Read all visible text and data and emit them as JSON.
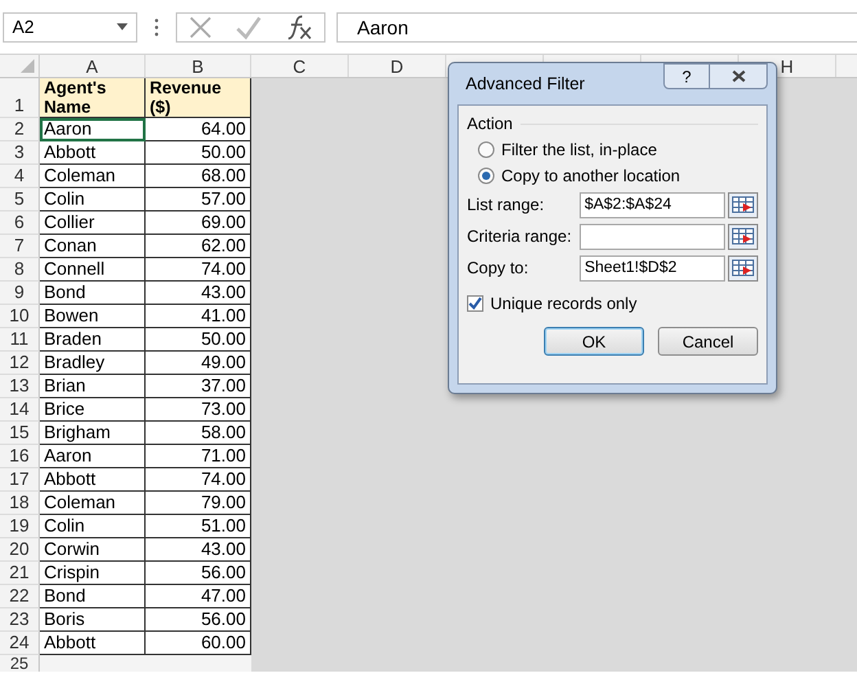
{
  "formula_bar": {
    "name_box": "A2",
    "formula": "Aaron"
  },
  "column_headers": [
    "A",
    "B",
    "C",
    "D"
  ],
  "column_header_right": "H",
  "header_row": {
    "row": "1",
    "cells": [
      "Agent's Name",
      "Revenue ($)"
    ]
  },
  "rows": [
    {
      "row": "2",
      "name": "Aaron",
      "revenue": "64.00",
      "selected": true
    },
    {
      "row": "3",
      "name": "Abbott",
      "revenue": "50.00",
      "selected": false
    },
    {
      "row": "4",
      "name": "Coleman",
      "revenue": "68.00",
      "selected": false
    },
    {
      "row": "5",
      "name": "Colin",
      "revenue": "57.00",
      "selected": false
    },
    {
      "row": "6",
      "name": "Collier",
      "revenue": "69.00",
      "selected": false
    },
    {
      "row": "7",
      "name": "Conan",
      "revenue": "62.00",
      "selected": false
    },
    {
      "row": "8",
      "name": "Connell",
      "revenue": "74.00",
      "selected": false
    },
    {
      "row": "9",
      "name": "Bond",
      "revenue": "43.00",
      "selected": false
    },
    {
      "row": "10",
      "name": "Bowen",
      "revenue": "41.00",
      "selected": false
    },
    {
      "row": "11",
      "name": "Braden",
      "revenue": "50.00",
      "selected": false
    },
    {
      "row": "12",
      "name": "Bradley",
      "revenue": "49.00",
      "selected": false
    },
    {
      "row": "13",
      "name": "Brian",
      "revenue": "37.00",
      "selected": false
    },
    {
      "row": "14",
      "name": "Brice",
      "revenue": "73.00",
      "selected": false
    },
    {
      "row": "15",
      "name": "Brigham",
      "revenue": "58.00",
      "selected": false
    },
    {
      "row": "16",
      "name": "Aaron",
      "revenue": "71.00",
      "selected": false
    },
    {
      "row": "17",
      "name": "Abbott",
      "revenue": "74.00",
      "selected": false
    },
    {
      "row": "18",
      "name": "Coleman",
      "revenue": "79.00",
      "selected": false
    },
    {
      "row": "19",
      "name": "Colin",
      "revenue": "51.00",
      "selected": false
    },
    {
      "row": "20",
      "name": "Corwin",
      "revenue": "43.00",
      "selected": false
    },
    {
      "row": "21",
      "name": "Crispin",
      "revenue": "56.00",
      "selected": false
    },
    {
      "row": "22",
      "name": "Bond",
      "revenue": "47.00",
      "selected": false
    },
    {
      "row": "23",
      "name": "Boris",
      "revenue": "56.00",
      "selected": false
    },
    {
      "row": "24",
      "name": "Abbott",
      "revenue": "60.00",
      "selected": false
    }
  ],
  "last_row": "25",
  "dialog": {
    "title": "Advanced Filter",
    "help": "?",
    "group": "Action",
    "options": [
      {
        "label": "Filter the list, in-place",
        "selected": false
      },
      {
        "label": "Copy to another location",
        "selected": true
      }
    ],
    "fields": [
      {
        "label": "List range:",
        "value": "$A$2:$A$24"
      },
      {
        "label": "Criteria range:"
      },
      {
        "label": "Copy to:",
        "value": "Sheet1!$D$2"
      }
    ],
    "unique": {
      "label": "Unique records only",
      "checked": true
    },
    "buttons": [
      {
        "label": "OK",
        "default": true
      },
      {
        "label": "Cancel",
        "default": false
      }
    ]
  }
}
